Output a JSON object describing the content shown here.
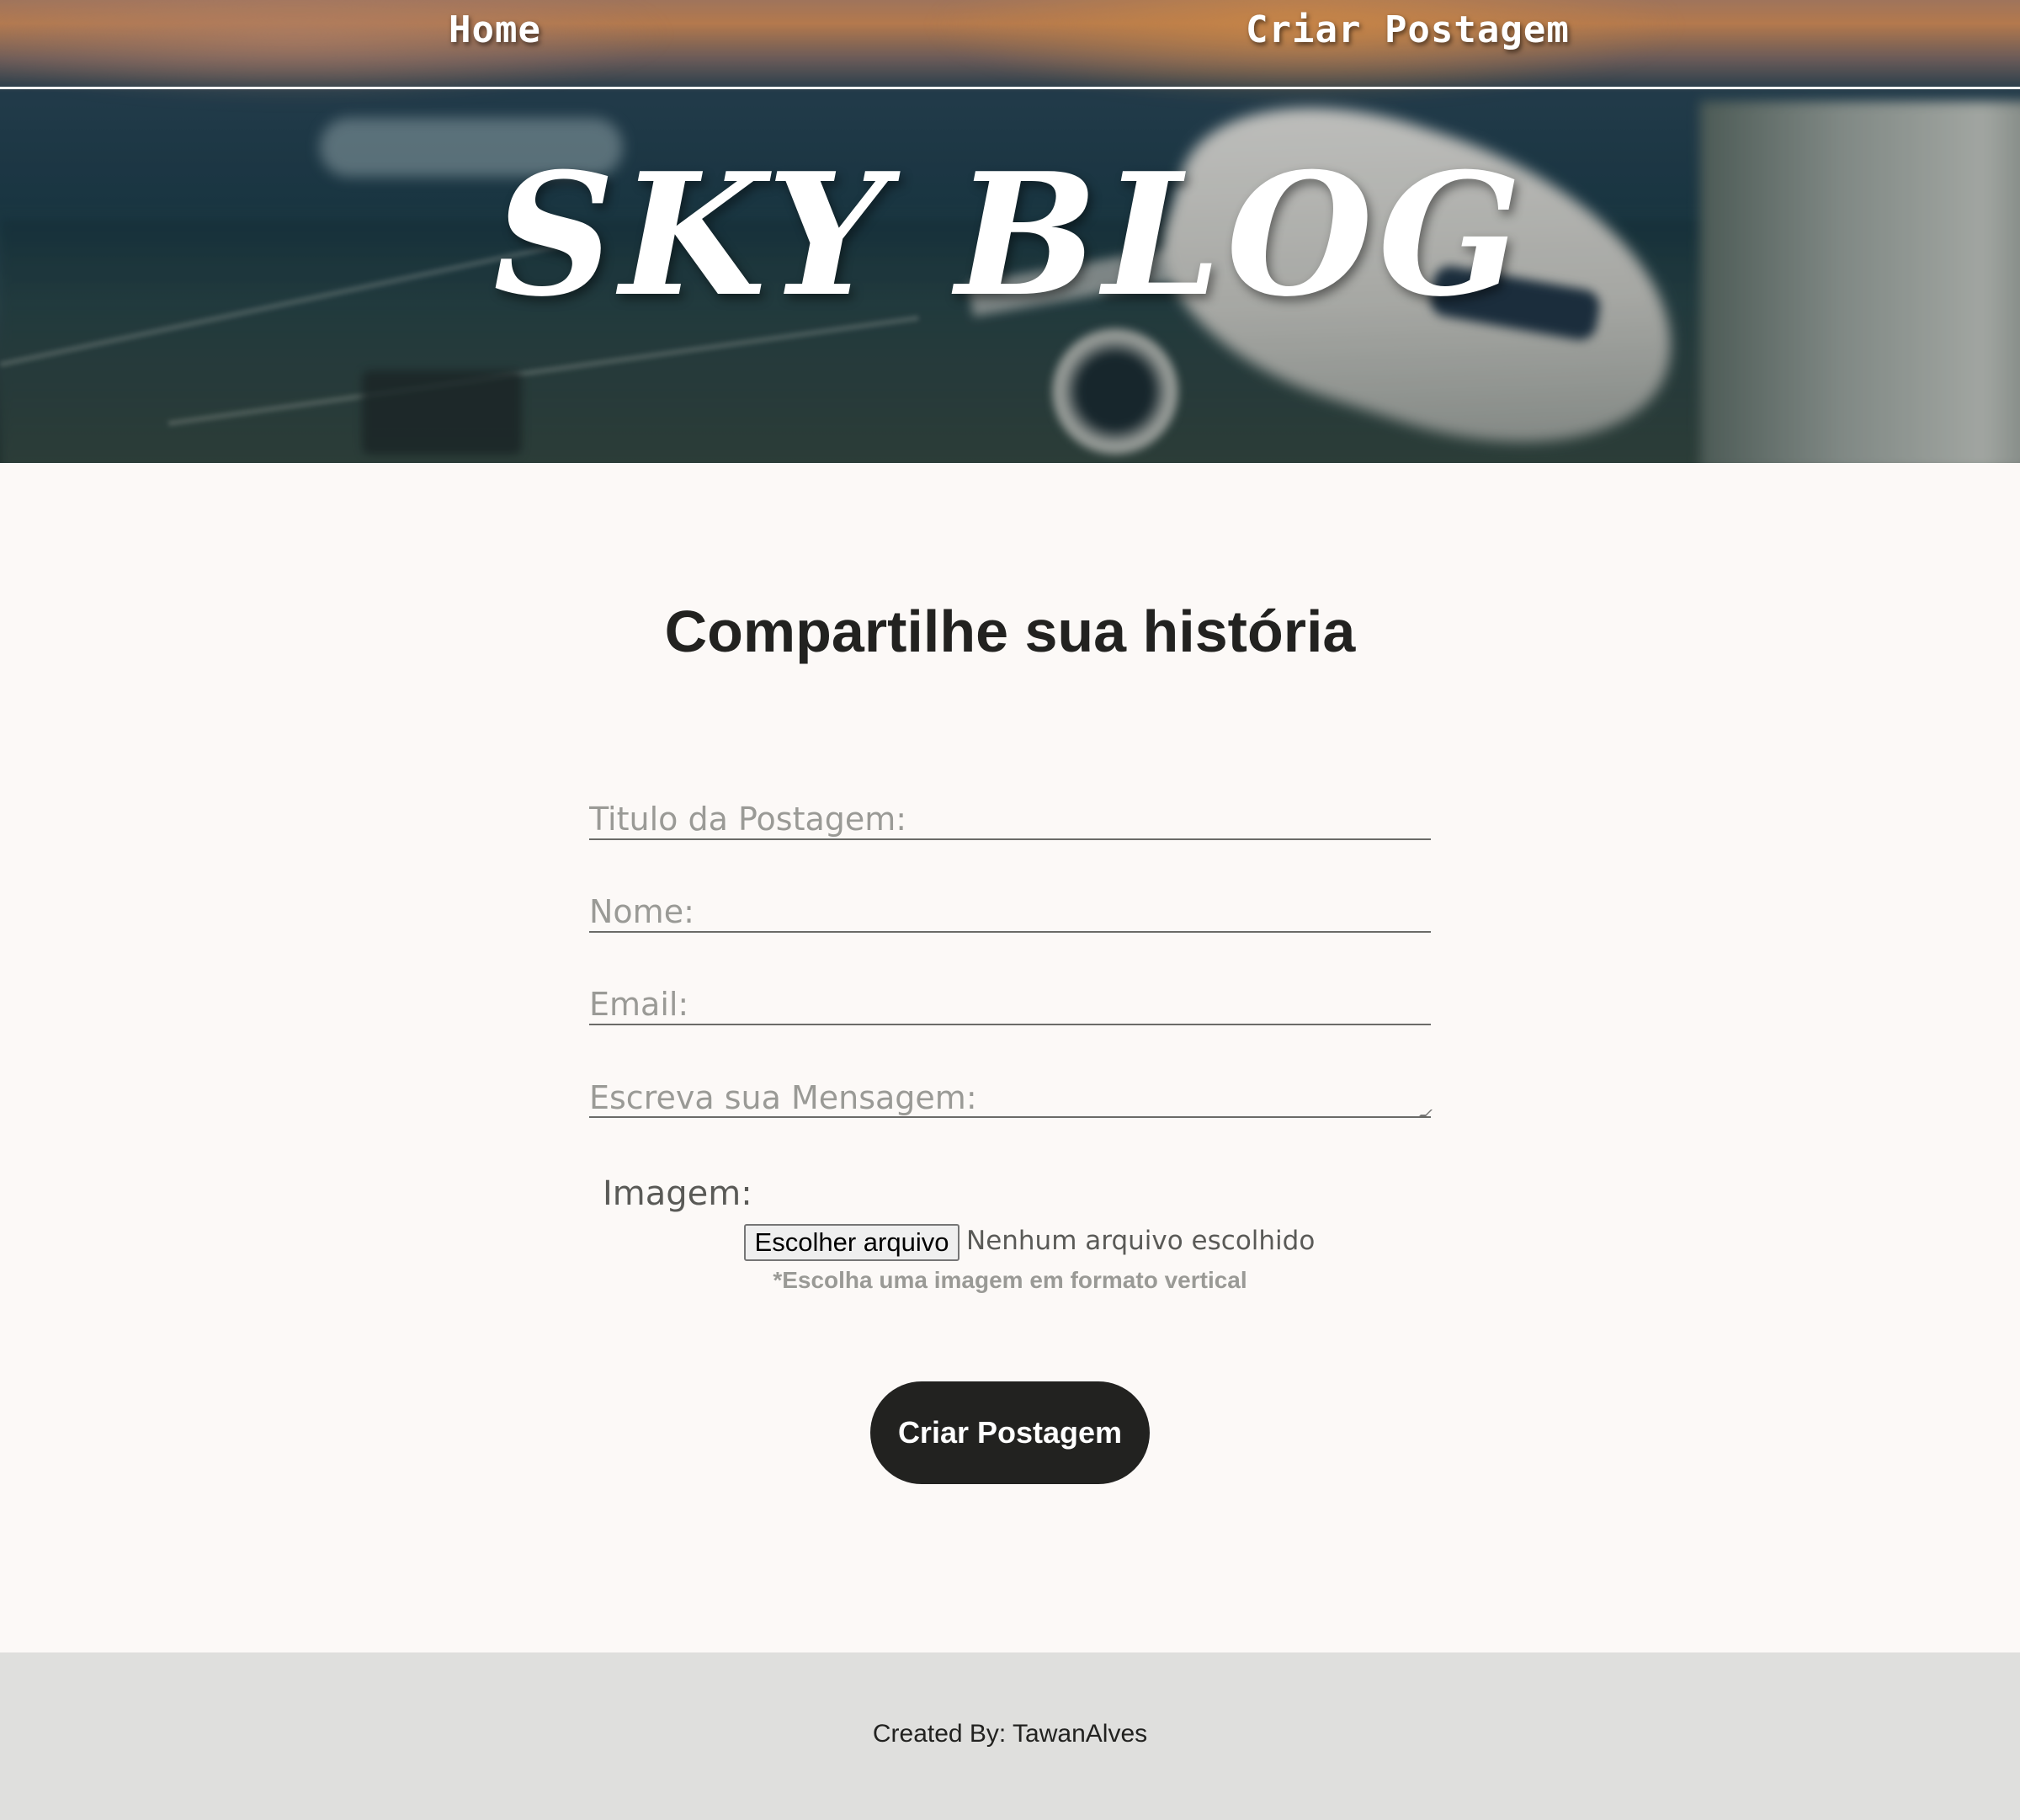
{
  "nav": {
    "home": "Home",
    "create_post": "Criar Postagem"
  },
  "brand": {
    "title": "SKY BLOG"
  },
  "form": {
    "heading": "Compartilhe sua história",
    "title_placeholder": "Titulo da Postagem:",
    "name_placeholder": "Nome:",
    "email_placeholder": "Email:",
    "message_placeholder": "Escreva sua Mensagem:",
    "image_label": "Imagem:",
    "file_button": "Escolher arquivo",
    "file_status": "Nenhum arquivo escolhido",
    "image_hint": "*Escolha uma imagem em formato vertical",
    "submit": "Criar Postagem"
  },
  "footer": {
    "credit": "Created By: TawanAlves"
  },
  "colors": {
    "page_bg": "#fcf9f7",
    "button_bg": "#222220",
    "footer_bg": "#dfdfdd",
    "placeholder": "#9a9a96"
  },
  "icons": {
    "resize_grip": "textarea-resize-grip-icon"
  }
}
